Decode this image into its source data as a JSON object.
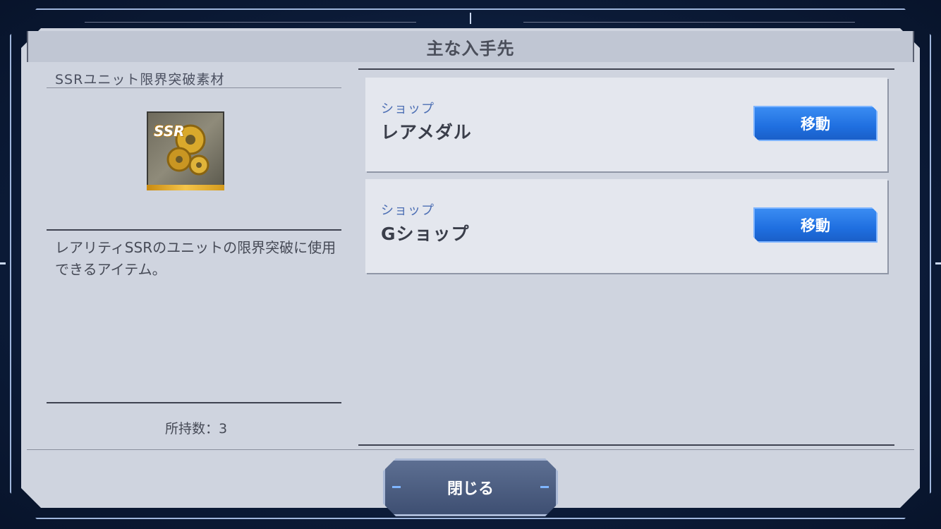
{
  "dialog": {
    "title": "主な入手先"
  },
  "item": {
    "name": "SSRユニット限界突破素材",
    "icon_badge": "SSR",
    "description": "レアリティSSRのユニットの限界突破に使用できるアイテム。",
    "owned": "所持数：3"
  },
  "sources": [
    {
      "category": "ショップ",
      "name": "レアメダル",
      "button_label": "移動"
    },
    {
      "category": "ショップ",
      "name": "Gショップ",
      "button_label": "移動"
    }
  ],
  "footer": {
    "close_label": "閉じる"
  },
  "colors": {
    "panel": "#cfd4df",
    "accent": "#1f6fe0",
    "category_text": "#4d6fb4"
  }
}
